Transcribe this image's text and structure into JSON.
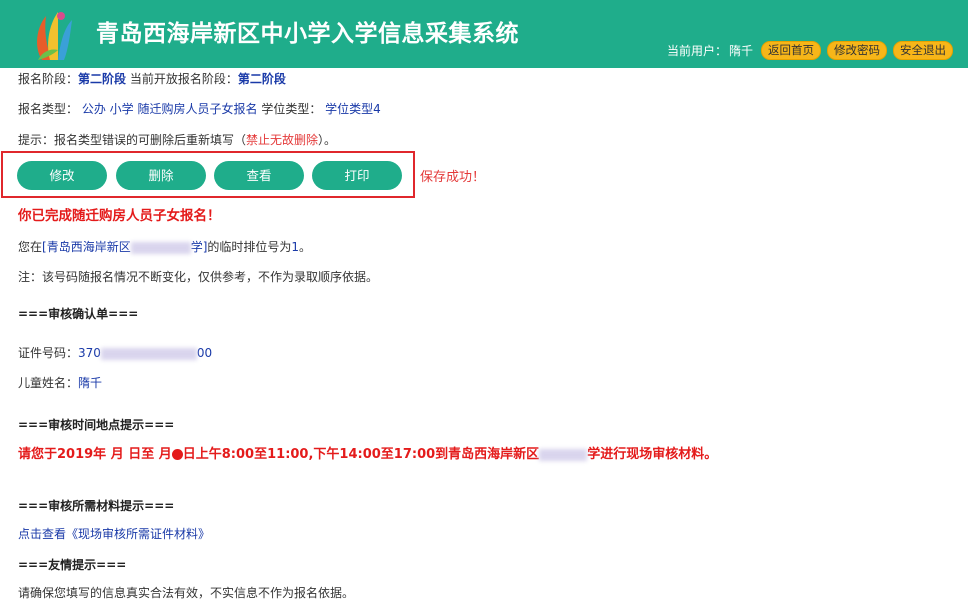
{
  "header": {
    "title": "青岛西海岸新区中小学入学信息采集系统",
    "current_user_label": "当前用户：",
    "current_user": "隋千",
    "buttons": [
      "返回首页",
      "修改密码",
      "安全退出"
    ]
  },
  "info": {
    "stage_label": "报名阶段：",
    "stage_value": "第二阶段",
    "open_stage_label": "当前开放报名阶段：",
    "open_stage_value": "第二阶段",
    "type_label": "报名类型：",
    "type_value": "公办 小学 随迁购房人员子女报名",
    "degree_label": "学位类型：",
    "degree_value": "学位类型4",
    "tip_prefix": "提示：报名类型错误的可删除后重新填写（",
    "tip_red": "禁止无故删除",
    "tip_suffix": "）。"
  },
  "actions": {
    "buttons": [
      "修改",
      "删除",
      "查看",
      "打印"
    ],
    "save_msg": "保存成功！"
  },
  "result": {
    "done_msg": "你已完成随迁购房人员子女报名！",
    "queue_prefix": "您在",
    "queue_school_a": "[青岛西海岸新区",
    "queue_school_b": "学]",
    "queue_mid": "的临时排位号为",
    "queue_no": "1",
    "queue_end": "。",
    "note": "注：该号码随报名情况不断变化，仅供参考，不作为录取顺序依据。"
  },
  "confirm": {
    "title": "===审核确认单===",
    "id_label": "证件号码：",
    "id_prefix": "370",
    "id_suffix": "00",
    "name_label": "儿童姓名：",
    "name_value": "隋千"
  },
  "time_place": {
    "title": "===审核时间地点提示===",
    "notice_a": "请您于2019年  月  日至  月",
    "notice_b": "日上午8:00至11:00,下午14:00至17:00到青岛西海岸新区",
    "notice_c": "学进行现场审核材料。"
  },
  "materials": {
    "title": "===审核所需材料提示===",
    "link": "点击查看《现场审核所需证件材料》"
  },
  "friendly": {
    "title": "===友情提示===",
    "text": "请确保您填写的信息真实合法有效，不实信息不作为报名依据。"
  },
  "colors": {
    "header_bg": "#1fad8b",
    "button_bg": "#1fad8b",
    "pill_bg": "#f7b619",
    "highlight_red": "#e41b1b",
    "link_blue": "#1a3aa8"
  }
}
